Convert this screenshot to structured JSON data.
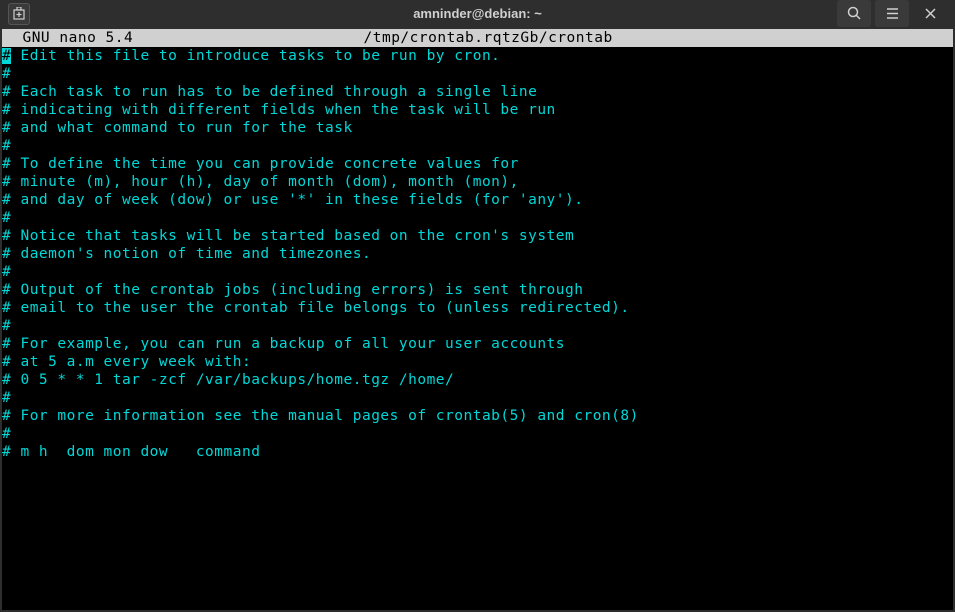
{
  "titlebar": {
    "title": "amninder@debian: ~"
  },
  "editor": {
    "status_left": "  GNU nano 5.4",
    "status_file": "/tmp/crontab.rqtzGb/crontab"
  },
  "lines": [
    "# Edit this file to introduce tasks to be run by cron.",
    "#",
    "# Each task to run has to be defined through a single line",
    "# indicating with different fields when the task will be run",
    "# and what command to run for the task",
    "#",
    "# To define the time you can provide concrete values for",
    "# minute (m), hour (h), day of month (dom), month (mon),",
    "# and day of week (dow) or use '*' in these fields (for 'any').",
    "#",
    "# Notice that tasks will be started based on the cron's system",
    "# daemon's notion of time and timezones.",
    "#",
    "# Output of the crontab jobs (including errors) is sent through",
    "# email to the user the crontab file belongs to (unless redirected).",
    "#",
    "# For example, you can run a backup of all your user accounts",
    "# at 5 a.m every week with:",
    "# 0 5 * * 1 tar -zcf /var/backups/home.tgz /home/",
    "#",
    "# For more information see the manual pages of crontab(5) and cron(8)",
    "#",
    "# m h  dom mon dow   command"
  ]
}
